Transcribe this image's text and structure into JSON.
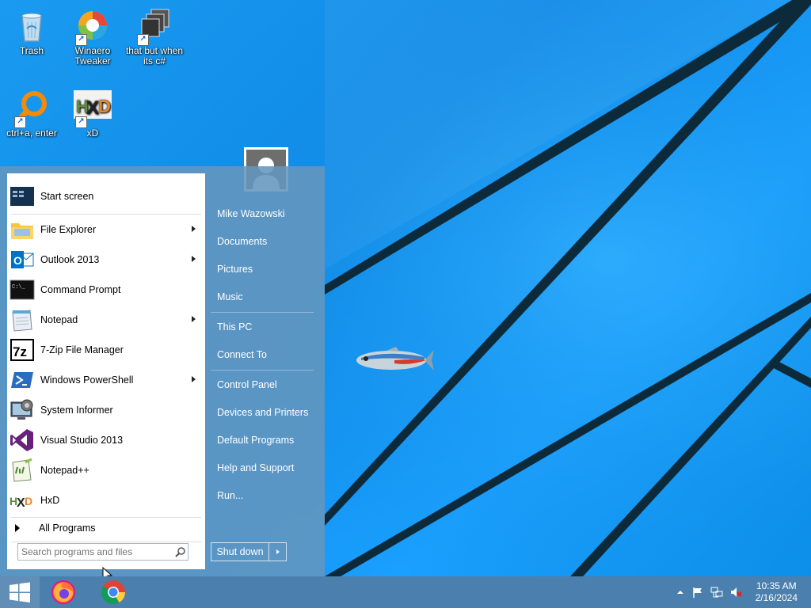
{
  "desktop": {
    "icons": [
      {
        "label": "Trash",
        "icon": "recycle-bin-icon"
      },
      {
        "label": "Winaero Tweaker",
        "icon": "winaero-tweaker-icon"
      },
      {
        "label": "that but when its c#",
        "icon": "stacked-windows-icon"
      },
      {
        "label": "ctrl+a, enter",
        "icon": "orange-magnifier-icon"
      },
      {
        "label": "xD",
        "icon": "hxd-icon"
      }
    ]
  },
  "start_menu": {
    "programs": [
      {
        "label": "Start screen",
        "icon": "start-screen-icon",
        "submenu": false
      },
      {
        "label": "File Explorer",
        "icon": "folder-icon",
        "submenu": true
      },
      {
        "label": "Outlook 2013",
        "icon": "outlook-icon",
        "submenu": true
      },
      {
        "label": "Command Prompt",
        "icon": "cmd-icon",
        "submenu": false
      },
      {
        "label": "Notepad",
        "icon": "notepad-icon",
        "submenu": true
      },
      {
        "label": "7-Zip File Manager",
        "icon": "7zip-icon",
        "submenu": false
      },
      {
        "label": "Windows PowerShell",
        "icon": "powershell-icon",
        "submenu": true
      },
      {
        "label": "System Informer",
        "icon": "system-informer-icon",
        "submenu": false
      },
      {
        "label": "Visual Studio 2013",
        "icon": "visual-studio-icon",
        "submenu": false
      },
      {
        "label": "Notepad++",
        "icon": "notepad-plus-plus-icon",
        "submenu": false
      },
      {
        "label": "HxD",
        "icon": "hxd-icon",
        "submenu": false
      }
    ],
    "all_programs": "All Programs",
    "search_placeholder": "Search programs and files",
    "user_name": "Mike Wazowski",
    "right_items": [
      "Documents",
      "Pictures",
      "Music",
      "This PC",
      "Connect To",
      "Control Panel",
      "Devices and Printers",
      "Default Programs",
      "Help and Support",
      "Run..."
    ],
    "shutdown_label": "Shut down"
  },
  "taskbar": {
    "apps": [
      "firefox-icon",
      "chrome-icon"
    ],
    "clock": {
      "time": "10:35 AM",
      "date": "2/16/2024"
    }
  }
}
